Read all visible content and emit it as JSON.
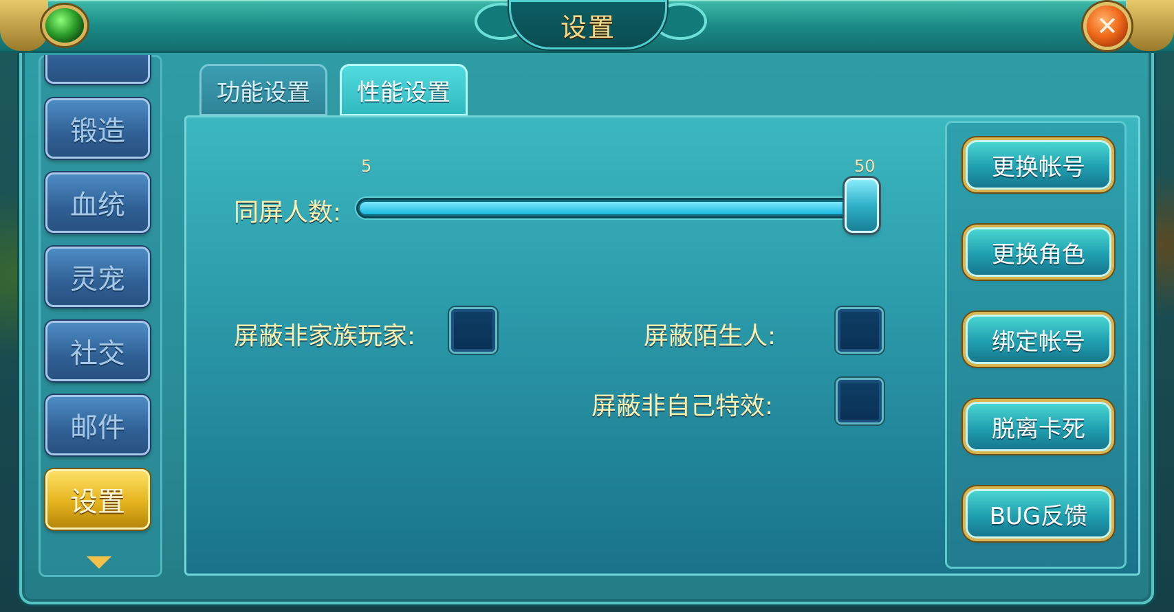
{
  "window": {
    "title": "设置",
    "close_icon": "close-icon"
  },
  "sidebar": {
    "items": [
      {
        "label": ""
      },
      {
        "label": "锻造"
      },
      {
        "label": "血统"
      },
      {
        "label": "灵宠"
      },
      {
        "label": "社交"
      },
      {
        "label": "邮件"
      },
      {
        "label": "设置",
        "active": true
      }
    ]
  },
  "tabs": [
    {
      "label": "功能设置",
      "active": false
    },
    {
      "label": "性能设置",
      "active": true
    }
  ],
  "performance": {
    "screen_players": {
      "label": "同屏人数:",
      "min": "5",
      "max": "50",
      "value": 50
    },
    "hide_non_clan_players": {
      "label": "屏蔽非家族玩家:",
      "checked": false
    },
    "hide_strangers": {
      "label": "屏蔽陌生人:",
      "checked": false
    },
    "hide_others_effects": {
      "label": "屏蔽非自己特效:",
      "checked": false
    }
  },
  "actions": [
    {
      "label": "更换帐号"
    },
    {
      "label": "更换角色"
    },
    {
      "label": "绑定帐号"
    },
    {
      "label": "脱离卡死"
    },
    {
      "label": "BUG反馈"
    }
  ]
}
